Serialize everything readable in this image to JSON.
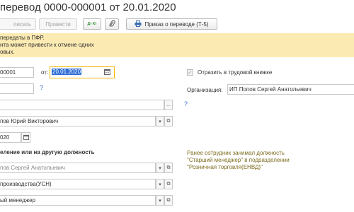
{
  "window": {
    "title": "перевод 0000-000001 от 20.01.2020"
  },
  "toolbar": {
    "post_close_label": "писать",
    "post_label": "Провести",
    "dt_kt_label": "Дт Кт",
    "order_label": "Приказ о переводе (Т-5)"
  },
  "warning": {
    "line1": "передаты в ПФР.",
    "line2": "нта может привести к отмене одних",
    "line3": "овых."
  },
  "form": {
    "number_value": "00001",
    "date_label": "от:",
    "date_value": "20.01.2020",
    "question_mark": "?",
    "employee_value": "пов Юрий Викторович",
    "period_value": "020",
    "section_heading": "еление или на другую должность",
    "manager_value": "пов Сергей Анатольевич",
    "division_value": "производства(УСН)",
    "position_value": "ый менеджер",
    "workbook_label": "Отразить в трудовой книжке",
    "workbook_checked": true,
    "org_label": "Организация:",
    "org_value": "ИП Попов Сергей Анатольевич",
    "previous_note": {
      "line1": "Ранее сотрудник занимал должность",
      "line2": "\"Старший менеджер\" в подразделении",
      "line3": "\"Розничная торговля(ЕНВД)\""
    }
  },
  "colors": {
    "warning_bg": "#fbeab2",
    "focus_border": "#f0b800",
    "selection": "#2f6fd6",
    "note_text": "#7d6b1e",
    "link_blue": "#3a6ecb"
  }
}
